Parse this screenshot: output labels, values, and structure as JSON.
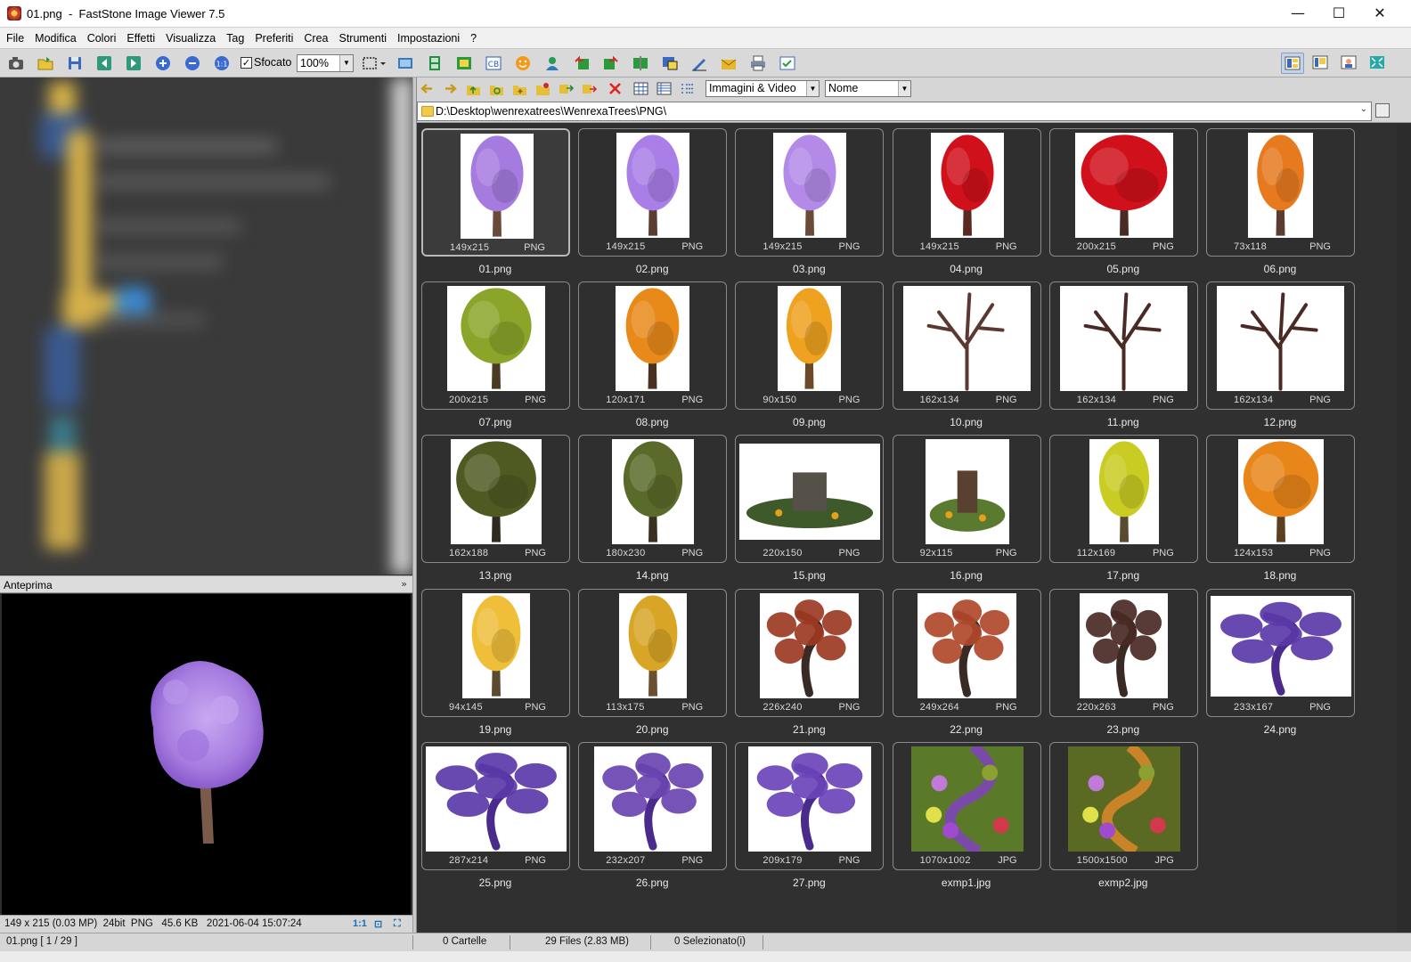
{
  "window": {
    "title": "01.png  -  FastStone Image Viewer 7.5",
    "minimize_glyph": "—",
    "maximize_glyph": "☐",
    "close_glyph": "✕"
  },
  "menu": [
    "File",
    "Modifica",
    "Colori",
    "Effetti",
    "Visualizza",
    "Tag",
    "Preferiti",
    "Crea",
    "Strumenti",
    "Impostazioni",
    "?"
  ],
  "toolbar": {
    "blur_label": "Sfocato",
    "blur_checked": true,
    "zoom_value": "100%"
  },
  "preview": {
    "header": "Anteprima",
    "info": "149 x 215 (0.03 MP)  24bit  PNG   45.6 KB   2021-06-04 15:07:24",
    "actual_size_label": "1:1"
  },
  "browser": {
    "filter_value": "Immagini & Video",
    "sort_value": "Nome",
    "path": "D:\\Desktop\\wenrexatrees\\WenrexaTrees\\PNG\\"
  },
  "files": [
    {
      "name": "01.png",
      "dims": "149x215",
      "fmt": "PNG",
      "kind": "tree",
      "foliage": "#a67be0",
      "trunk": "#6b4a3a",
      "selected": true
    },
    {
      "name": "02.png",
      "dims": "149x215",
      "fmt": "PNG",
      "kind": "tree",
      "foliage": "#a97ee6",
      "trunk": "#5a3d30"
    },
    {
      "name": "03.png",
      "dims": "149x215",
      "fmt": "PNG",
      "kind": "tree",
      "foliage": "#b38ae8",
      "trunk": "#6b4a3a"
    },
    {
      "name": "04.png",
      "dims": "149x215",
      "fmt": "PNG",
      "kind": "tree",
      "foliage": "#d0101a",
      "trunk": "#5a2a22"
    },
    {
      "name": "05.png",
      "dims": "200x215",
      "fmt": "PNG",
      "kind": "wide",
      "foliage": "#d0101a",
      "trunk": "#4a2a22"
    },
    {
      "name": "06.png",
      "dims": "73x118",
      "fmt": "PNG",
      "kind": "tree",
      "foliage": "#e77a1f",
      "trunk": "#5a3d30"
    },
    {
      "name": "07.png",
      "dims": "200x215",
      "fmt": "PNG",
      "kind": "tree",
      "foliage": "#8aa52a",
      "trunk": "#4a3a22"
    },
    {
      "name": "08.png",
      "dims": "120x171",
      "fmt": "PNG",
      "kind": "tree",
      "foliage": "#e88a1a",
      "trunk": "#4a3020"
    },
    {
      "name": "09.png",
      "dims": "90x150",
      "fmt": "PNG",
      "kind": "tree",
      "foliage": "#eea21f",
      "trunk": "#6b4a2a"
    },
    {
      "name": "10.png",
      "dims": "162x134",
      "fmt": "PNG",
      "kind": "bare",
      "foliage": "#5a3a30",
      "trunk": "#5a3a30"
    },
    {
      "name": "11.png",
      "dims": "162x134",
      "fmt": "PNG",
      "kind": "bare",
      "foliage": "#4a2a25",
      "trunk": "#4a2a25"
    },
    {
      "name": "12.png",
      "dims": "162x134",
      "fmt": "PNG",
      "kind": "bare",
      "foliage": "#4a2a25",
      "trunk": "#4a2a25"
    },
    {
      "name": "13.png",
      "dims": "162x188",
      "fmt": "PNG",
      "kind": "wide",
      "foliage": "#4f5a22",
      "trunk": "#2e2a20"
    },
    {
      "name": "14.png",
      "dims": "180x230",
      "fmt": "PNG",
      "kind": "tree",
      "foliage": "#5a6a2a",
      "trunk": "#3a3020"
    },
    {
      "name": "15.png",
      "dims": "220x150",
      "fmt": "PNG",
      "kind": "stump",
      "foliage": "#3e5a2a",
      "trunk": "#555048"
    },
    {
      "name": "16.png",
      "dims": "92x115",
      "fmt": "PNG",
      "kind": "stump",
      "foliage": "#5a7a30",
      "trunk": "#5a4030"
    },
    {
      "name": "17.png",
      "dims": "112x169",
      "fmt": "PNG",
      "kind": "tree",
      "foliage": "#c9cc22",
      "trunk": "#5a4a30"
    },
    {
      "name": "18.png",
      "dims": "124x153",
      "fmt": "PNG",
      "kind": "wide",
      "foliage": "#e8861a",
      "trunk": "#5a4020"
    },
    {
      "name": "19.png",
      "dims": "94x145",
      "fmt": "PNG",
      "kind": "tree",
      "foliage": "#efbf3a",
      "trunk": "#5a4a30"
    },
    {
      "name": "20.png",
      "dims": "113x175",
      "fmt": "PNG",
      "kind": "tree",
      "foliage": "#d8a526",
      "trunk": "#6a5030"
    },
    {
      "name": "21.png",
      "dims": "226x240",
      "fmt": "PNG",
      "kind": "gnarled",
      "foliage": "#9c3a22",
      "trunk": "#3a2a25"
    },
    {
      "name": "22.png",
      "dims": "249x264",
      "fmt": "PNG",
      "kind": "gnarled",
      "foliage": "#b0482a",
      "trunk": "#3a2a25"
    },
    {
      "name": "23.png",
      "dims": "220x263",
      "fmt": "PNG",
      "kind": "gnarled",
      "foliage": "#4a2a25",
      "trunk": "#3a2a25"
    },
    {
      "name": "24.png",
      "dims": "233x167",
      "fmt": "PNG",
      "kind": "gnarled",
      "foliage": "#5a3aa8",
      "trunk": "#4a2a8a"
    },
    {
      "name": "25.png",
      "dims": "287x214",
      "fmt": "PNG",
      "kind": "gnarled",
      "foliage": "#5a3aa8",
      "trunk": "#4a2a8a"
    },
    {
      "name": "26.png",
      "dims": "232x207",
      "fmt": "PNG",
      "kind": "gnarled",
      "foliage": "#6a44b0",
      "trunk": "#4a2a8a"
    },
    {
      "name": "27.png",
      "dims": "209x179",
      "fmt": "PNG",
      "kind": "gnarled",
      "foliage": "#6a44b8",
      "trunk": "#4a2a8a"
    },
    {
      "name": "exmp1.jpg",
      "dims": "1070x1002",
      "fmt": "JPG",
      "kind": "scene",
      "foliage": "#7a4aa8",
      "trunk": "#5a7a2a"
    },
    {
      "name": "exmp2.jpg",
      "dims": "1500x1500",
      "fmt": "JPG",
      "kind": "scene",
      "foliage": "#c9842a",
      "trunk": "#5a6a22"
    }
  ],
  "status": {
    "current": "01.png [ 1 / 29 ]",
    "folders": "0 Cartelle",
    "files": "29 Files (2.83 MB)",
    "selected": "0 Selezionato(i)"
  }
}
